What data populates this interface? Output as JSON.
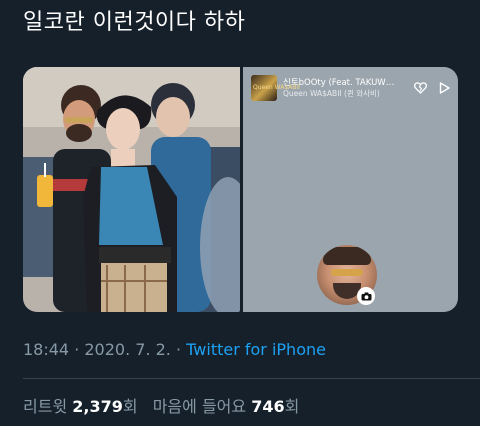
{
  "tweet": {
    "text": "일코란 이런것이다 하하"
  },
  "media": {
    "music": {
      "title": "신토bOOty (Feat. TAKUW…",
      "artist": "Queen WA$ABII (퀸 와사비)",
      "album_art_text": "Queen WA$ABII"
    }
  },
  "meta": {
    "time": "18:44",
    "date": "2020. 7. 2.",
    "separator": " · ",
    "source": "Twitter for iPhone"
  },
  "stats": {
    "retweets_label": "리트윗",
    "retweets_count": "2,379",
    "retweets_suffix": "회",
    "likes_label": "마음에 들어요",
    "likes_count": "746",
    "likes_suffix": "회"
  }
}
